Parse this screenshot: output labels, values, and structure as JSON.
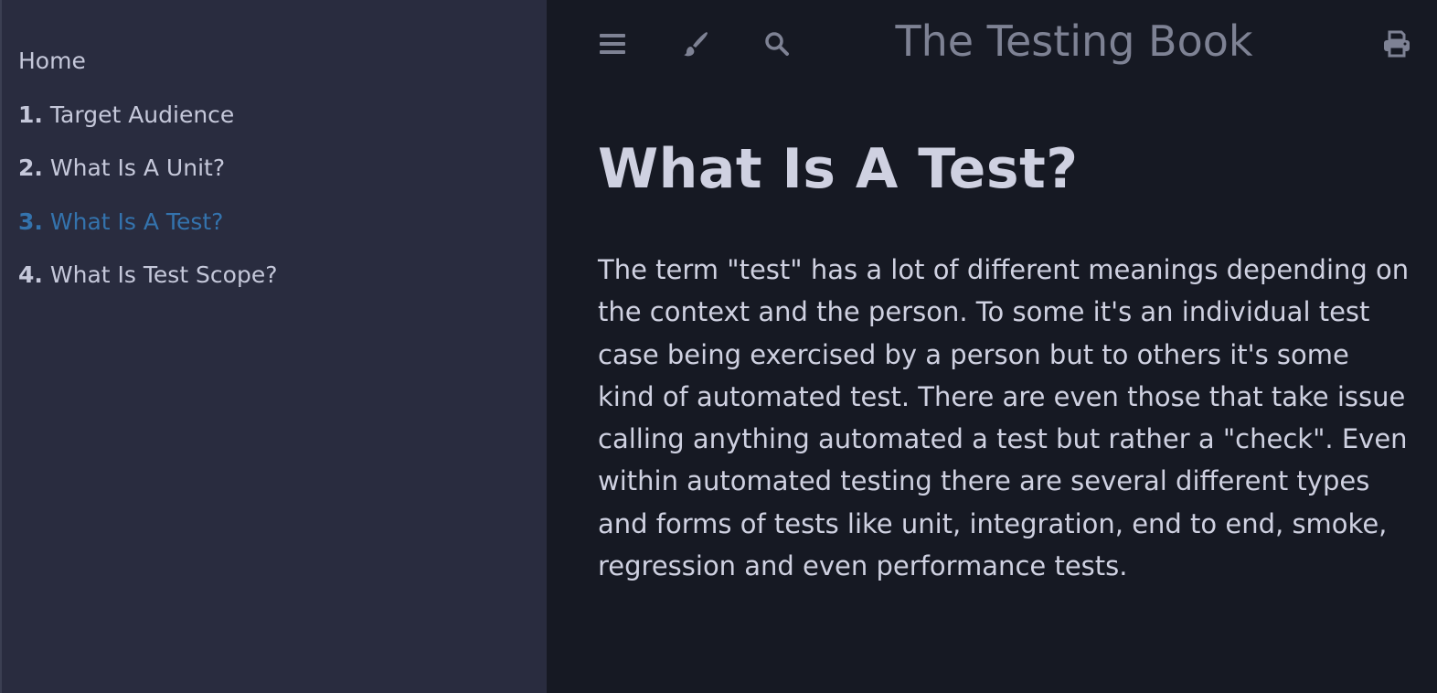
{
  "sidebar": {
    "items": [
      {
        "num": "",
        "label": "Home",
        "active": false
      },
      {
        "num": "1.",
        "label": "Target Audience",
        "active": false
      },
      {
        "num": "2.",
        "label": "What Is A Unit?",
        "active": false
      },
      {
        "num": "3.",
        "label": "What Is A Test?",
        "active": true
      },
      {
        "num": "4.",
        "label": "What Is Test Scope?",
        "active": false
      }
    ]
  },
  "menubar": {
    "title": "The Testing Book",
    "icons": [
      "hamburger-icon",
      "paintbrush-icon",
      "search-icon",
      "print-icon"
    ]
  },
  "content": {
    "heading": "What Is A Test?",
    "paragraph": "The term \"test\" has a lot of different meanings depending on the context and the person. To some it's an individual test case being exercised by a person but to others it's some kind of automated test. There are even those that take issue calling anything automated a test but rather a \"check\". Even within automated testing there are several different types and forms of tests like unit, integration, end to end, smoke, regression and even performance tests."
  },
  "colors": {
    "sidebar_bg": "#292c3f",
    "main_bg": "#161923",
    "text": "#c5c8da",
    "active_link": "#3473ad",
    "icon": "#7e8294"
  }
}
